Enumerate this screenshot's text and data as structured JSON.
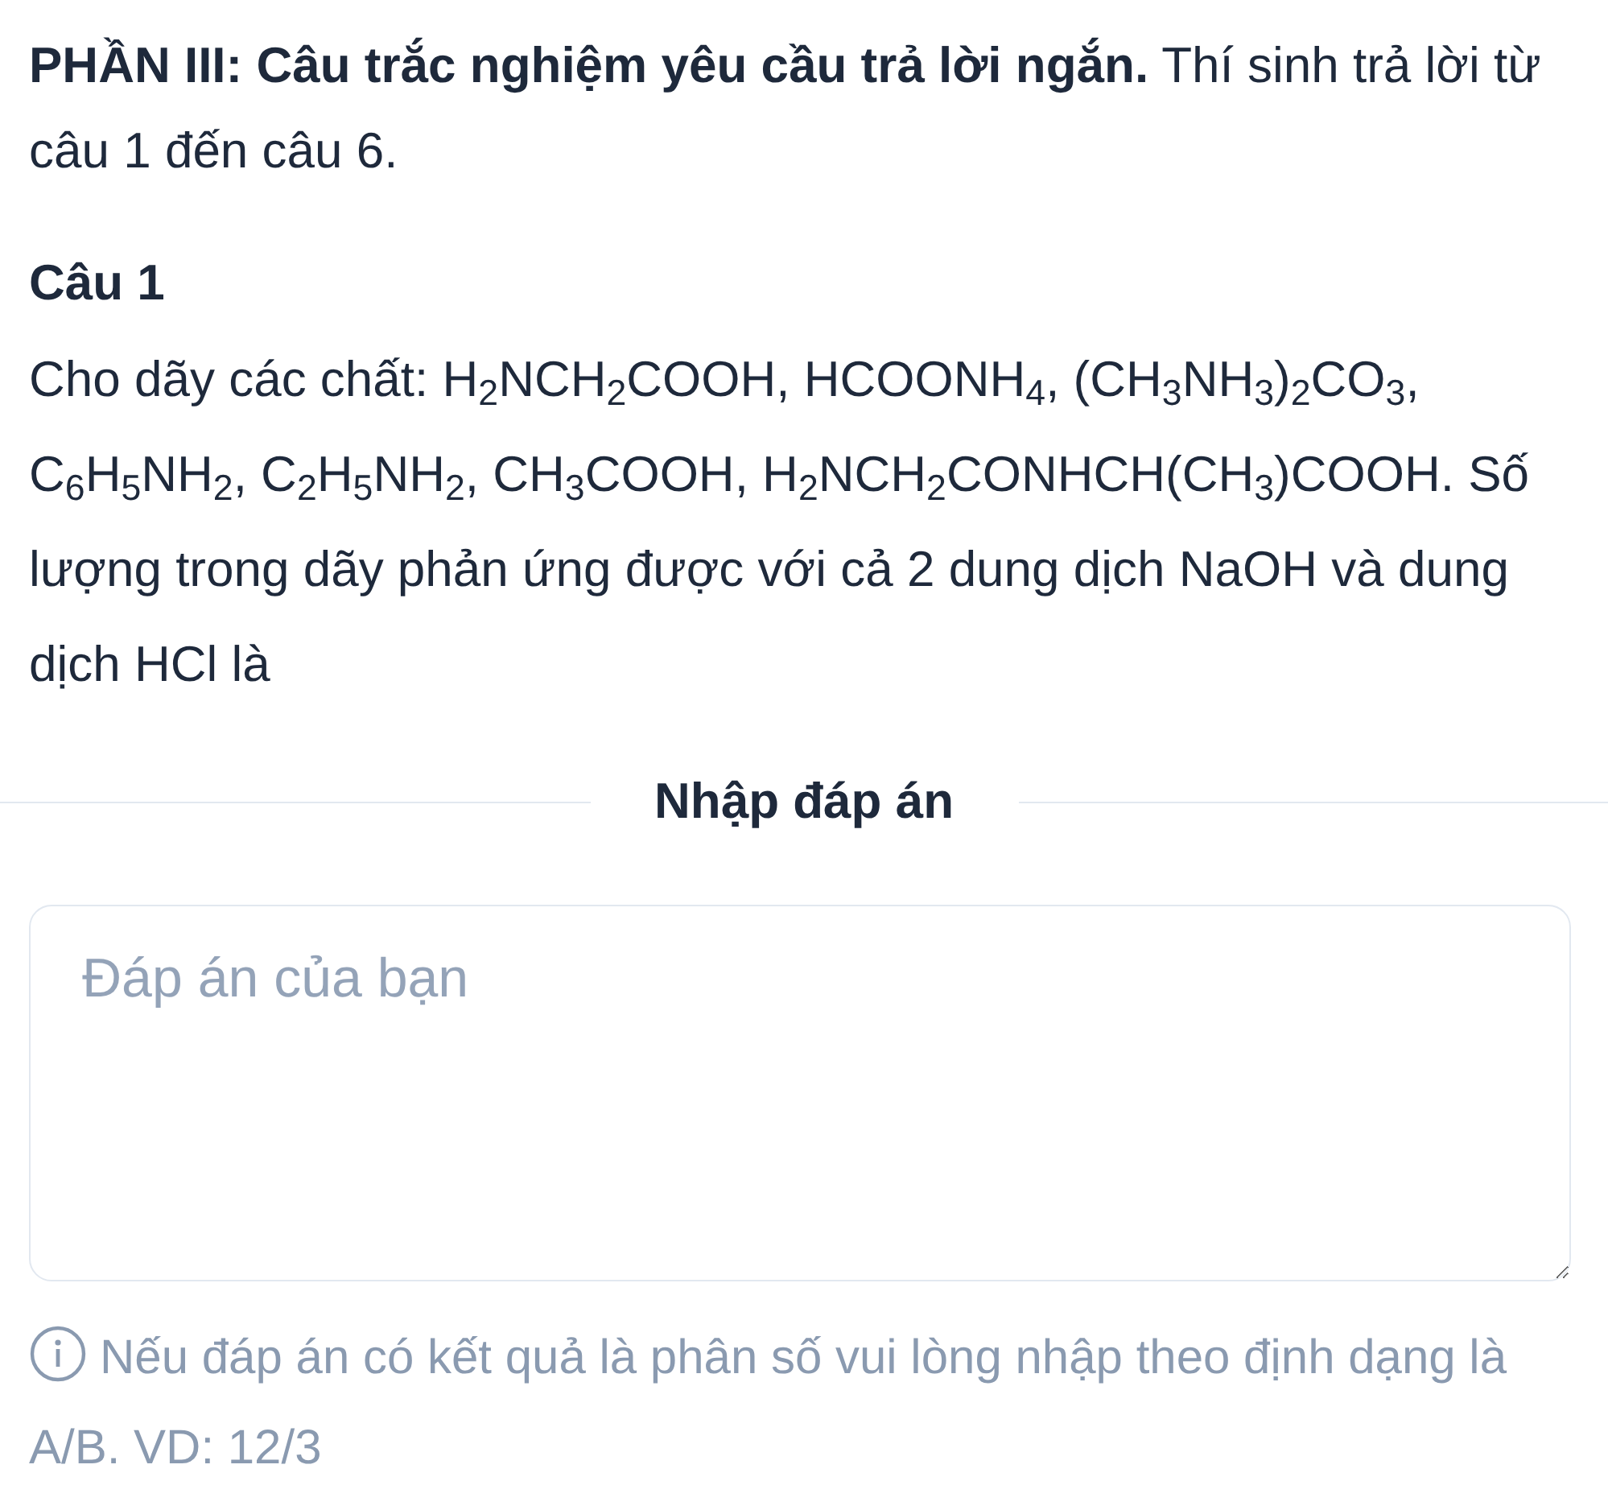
{
  "section_heading": "**PHẦN III: Câu trắc nghiệm yêu cầu trả lời ngắn.** Thí sinh trả lời từ câu 1 đến câu 6.",
  "question": {
    "title": "Câu 1",
    "text": "Cho dãy các chất: H$_{2}$NCH$_{2}$COOH, HCOONH$_{4}$, (CH$_{3}$NH$_{3}$)$_{2}$CO$_{3}$, C$_{6}$H$_{5}$NH$_{2}$, C$_{2}$H$_{5}$NH$_{2}$, CH$_{3}$COOH, H$_{2}$NCH$_{2}$CONHCH(CH$_{3}$)COOH. Số lượng trong dãy phản ứng được với cả 2 dung dịch NaOH và dung dịch HCl là"
  },
  "answer": {
    "divider_label": "Nhập đáp án",
    "placeholder": "Đáp án của bạn",
    "hint": "Nếu đáp án có kết quả là phân số vui lòng nhập theo định dạng là A/B. VD: 12/3"
  }
}
